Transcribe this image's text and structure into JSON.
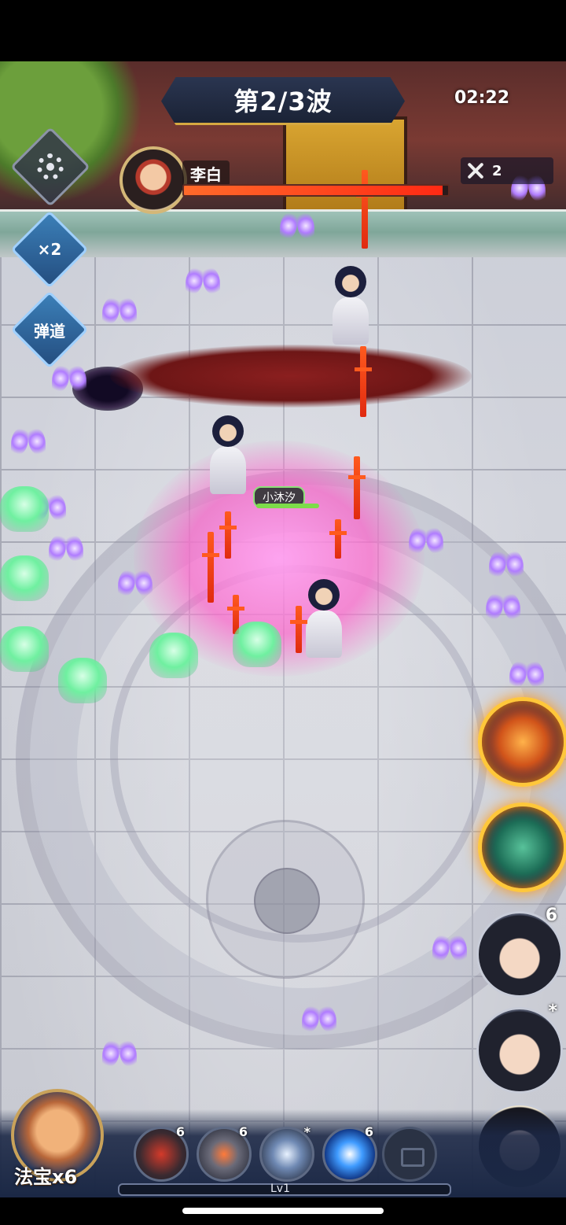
{
  "hud": {
    "wave": "第2/3波",
    "timer": "02:22",
    "boss_name": "李白",
    "boss_hp_fraction": 0.98,
    "kill_count": "2"
  },
  "left_buttons": {
    "speed": "×2",
    "path": "弹道"
  },
  "ally": {
    "name": "小沐汐"
  },
  "skills": {
    "slots": [
      {
        "icon": "red-slash-skill-icon",
        "count": "6"
      },
      {
        "icon": "flame-sword-skill-icon",
        "count": "6"
      },
      {
        "icon": "ice-wind-skill-icon",
        "count": "*"
      },
      {
        "icon": "blue-star-skill-icon",
        "count": "6"
      },
      {
        "icon": "locked-slot-icon",
        "count": ""
      }
    ],
    "level": "Lv1"
  },
  "treasure": {
    "label": "法宝x6"
  },
  "portraits": [
    {
      "badge": "6"
    },
    {
      "badge": "*"
    },
    {
      "badge": ""
    }
  ],
  "colors": {
    "accent": "#d7a941",
    "boss_hp": "#ff3a1a",
    "speed_btn": "#3b7fb8"
  }
}
